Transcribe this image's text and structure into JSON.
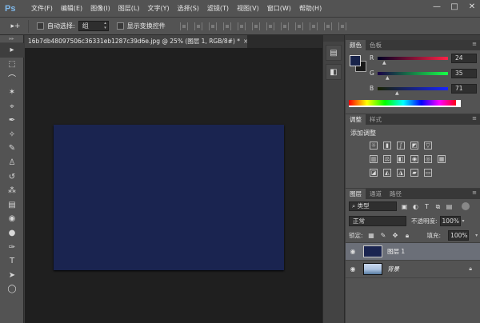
{
  "app": {
    "logo": "Ps"
  },
  "menu": [
    "文件(F)",
    "编辑(E)",
    "图像(I)",
    "图层(L)",
    "文字(Y)",
    "选择(S)",
    "滤镜(T)",
    "视图(V)",
    "窗口(W)",
    "帮助(H)"
  ],
  "window_controls": {
    "minimize": "—",
    "restore": "□",
    "close": "✕"
  },
  "options": {
    "tool_glyph": "▸+",
    "auto_select_label": "自动选择:",
    "auto_select_value": "组",
    "show_transform_label": "显示变换控件"
  },
  "document": {
    "tab_title": "16b7db48097506c36331eb1287c39d6e.jpg @ 25% (图层 1, RGB/8#) *",
    "close_glyph": "×",
    "canvas_color": "#1a2450"
  },
  "tools": [
    "▸",
    "⬚",
    "⌒",
    "✶",
    "⌖",
    "✒",
    "✧",
    "✎",
    "♙",
    "↺",
    "⁂",
    "▤",
    "◉",
    "●",
    "✑",
    "T",
    "➤",
    "◯"
  ],
  "color_panel": {
    "tabs": [
      "颜色",
      "色板"
    ],
    "r_label": "R",
    "r_value": "24",
    "g_label": "G",
    "g_value": "35",
    "b_label": "B",
    "b_value": "71",
    "foreground": "#18234a"
  },
  "adjust_panel": {
    "tabs": [
      "调整",
      "样式"
    ],
    "title": "添加调整"
  },
  "layers_panel": {
    "tabs": [
      "图层",
      "通道",
      "路径"
    ],
    "kind_label": "⌕ 类型",
    "blend_mode": "正常",
    "opacity_label": "不透明度:",
    "opacity_value": "100%",
    "lock_label": "锁定:",
    "fill_label": "填充:",
    "fill_value": "100%",
    "layers": [
      {
        "name": "图层 1",
        "selected": true
      },
      {
        "name": "背景",
        "selected": false
      }
    ]
  }
}
